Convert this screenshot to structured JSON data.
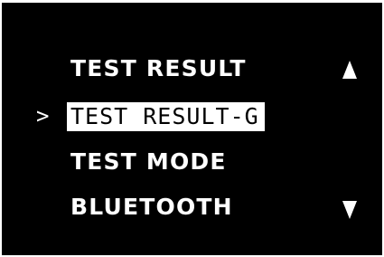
{
  "menu": {
    "cursor": ">",
    "items": [
      {
        "label": "TEST RESULT"
      },
      {
        "label": "TEST RESULT-G"
      },
      {
        "label": "TEST MODE"
      },
      {
        "label": "BLUETOOTH"
      }
    ],
    "selected_index": 1,
    "scroll_up_icon": "triangle-up-icon",
    "scroll_down_icon": "triangle-down-icon"
  },
  "colors": {
    "screen_background": "#000000",
    "text": "#ffffff",
    "selection_background": "#ffffff",
    "selection_text": "#000000"
  }
}
